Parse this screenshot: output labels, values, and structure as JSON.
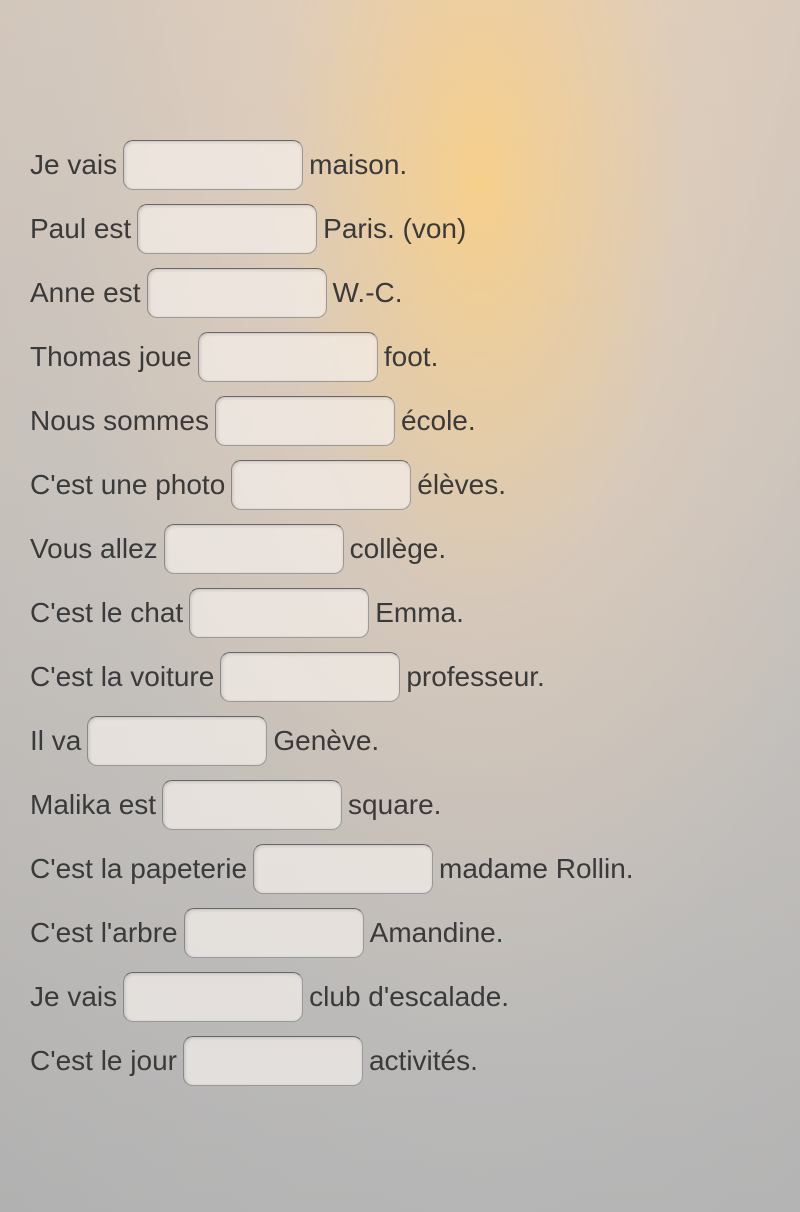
{
  "exercise": {
    "rows": [
      {
        "before": "Je vais",
        "value": "",
        "after": "maison."
      },
      {
        "before": "Paul est",
        "value": "",
        "after": "Paris. (von)"
      },
      {
        "before": "Anne est",
        "value": "",
        "after": "W.-C."
      },
      {
        "before": "Thomas joue",
        "value": "",
        "after": "foot."
      },
      {
        "before": "Nous sommes",
        "value": "",
        "after": "école."
      },
      {
        "before": "C'est une photo",
        "value": "",
        "after": "élèves."
      },
      {
        "before": "Vous allez",
        "value": "",
        "after": "collège."
      },
      {
        "before": "C'est le chat",
        "value": "",
        "after": "Emma."
      },
      {
        "before": "C'est la voiture",
        "value": "",
        "after": "professeur."
      },
      {
        "before": "Il va",
        "value": "",
        "after": "Genève."
      },
      {
        "before": "Malika est",
        "value": "",
        "after": "square."
      },
      {
        "before": "C'est la papeterie",
        "value": "",
        "after": "madame Rollin."
      },
      {
        "before": "C'est l'arbre",
        "value": "",
        "after": "Amandine."
      },
      {
        "before": "Je vais",
        "value": "",
        "after": "club d'escalade."
      },
      {
        "before": "C'est le jour",
        "value": "",
        "after": "activités."
      }
    ]
  }
}
